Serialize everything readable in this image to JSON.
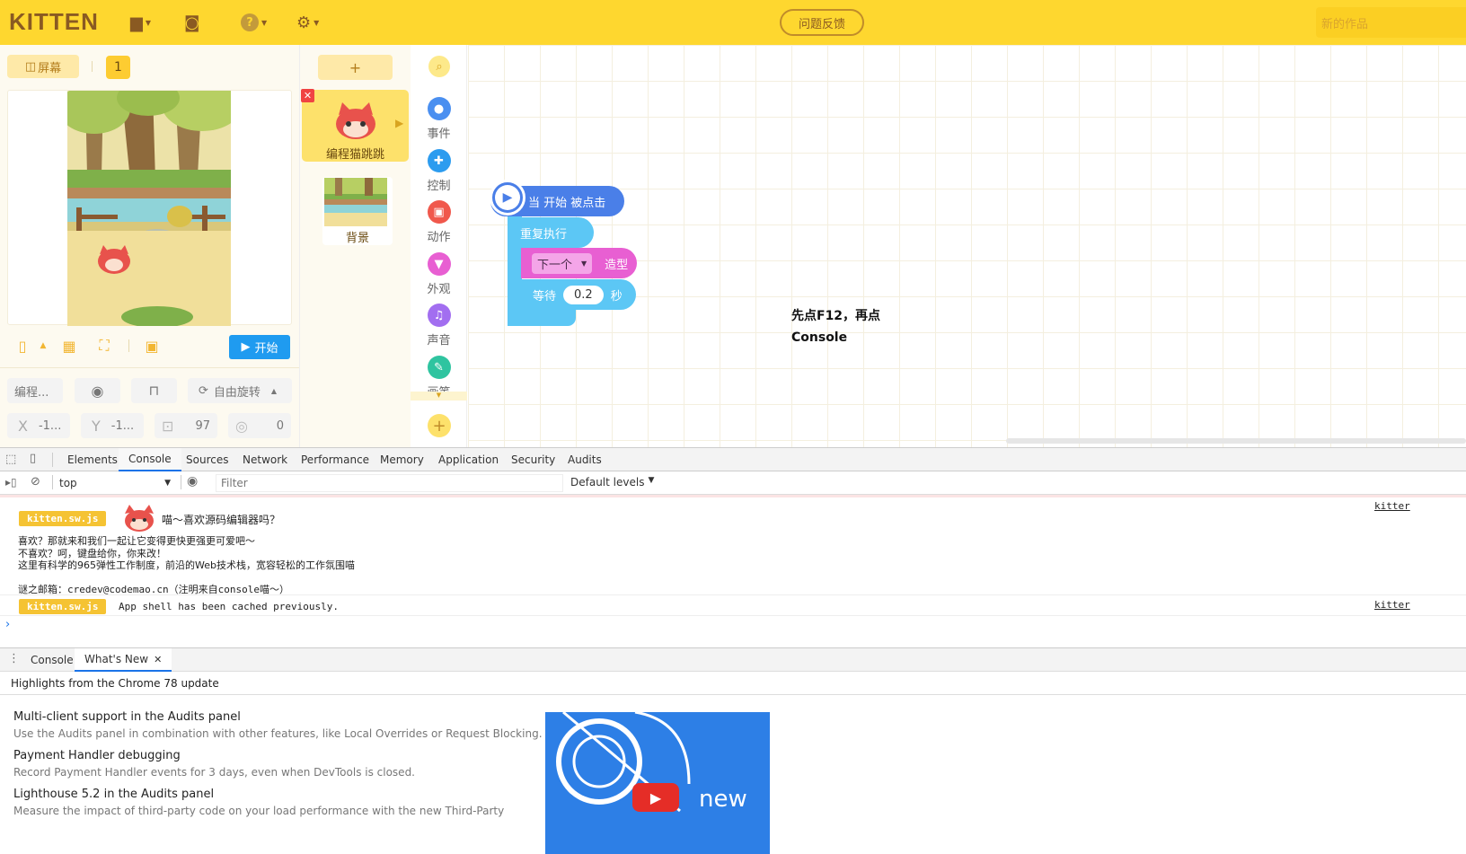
{
  "topbar": {
    "logo": "KITTEN",
    "feedback": "问题反馈",
    "work_name_placeholder": "新的作品"
  },
  "stage": {
    "screen_label": "屏幕",
    "page_number": "1",
    "start_label": "开始"
  },
  "sprite_props": {
    "name": "编程...",
    "rotation": "自由旋转",
    "x_label": "X",
    "x_value": "-1...",
    "y_label": "Y",
    "y_value": "-1...",
    "size": "97",
    "direction": "0"
  },
  "sprites": {
    "add": "+",
    "sprite_name": "编程猫跳跳",
    "background_name": "背景"
  },
  "categories": [
    {
      "label": "事件",
      "color": "#4a8ff0"
    },
    {
      "label": "控制",
      "color": "#2c9cef"
    },
    {
      "label": "动作",
      "color": "#f0584c"
    },
    {
      "label": "外观",
      "color": "#e85fd2"
    },
    {
      "label": "声音",
      "color": "#a26ef0"
    },
    {
      "label": "画笔",
      "color": "#2fc4a0"
    }
  ],
  "blocks": {
    "when_start": "当 开始 被点击",
    "repeat": "重复执行",
    "next": "下一个",
    "costume": "造型",
    "wait": "等待",
    "wait_value": "0.2",
    "seconds": "秒"
  },
  "note": {
    "line1": "先点F12，再点",
    "line2": "Console"
  },
  "devtools": {
    "tabs": [
      "Elements",
      "Console",
      "Sources",
      "Network",
      "Performance",
      "Memory",
      "Application",
      "Security",
      "Audits"
    ],
    "context": "top",
    "filter_placeholder": "Filter",
    "levels": "Default levels",
    "console": {
      "tag": "kitten.sw.js",
      "greeting": "喵～喜欢源码编辑器吗？",
      "line1": "喜欢？那就来和我们一起让它变得更快更强更可爱吧～",
      "line2": "不喜欢？呵，键盘给你，你来改！",
      "line3": "这里有科学的965弹性工作制度，前沿的Web技术栈，宽容轻松的工作氛围喵",
      "email": "谜之邮箱：credev@codemao.cn（注明来自console喵～）",
      "cached": "App shell has been cached previously.",
      "source": "kitter"
    },
    "drawer_tabs": [
      "Console",
      "What's New"
    ],
    "highlights": "Highlights from the Chrome 78 update",
    "items": [
      {
        "title": "Multi-client support in the Audits panel",
        "desc": "Use the Audits panel in combination with other features, like Local Overrides or Request Blocking."
      },
      {
        "title": "Payment Handler debugging",
        "desc": "Record Payment Handler events for 3 days, even when DevTools is closed."
      },
      {
        "title": "Lighthouse 5.2 in the Audits panel",
        "desc": "Measure the impact of third-party code on your load performance with the new Third-Party"
      }
    ],
    "video_text": "new"
  }
}
